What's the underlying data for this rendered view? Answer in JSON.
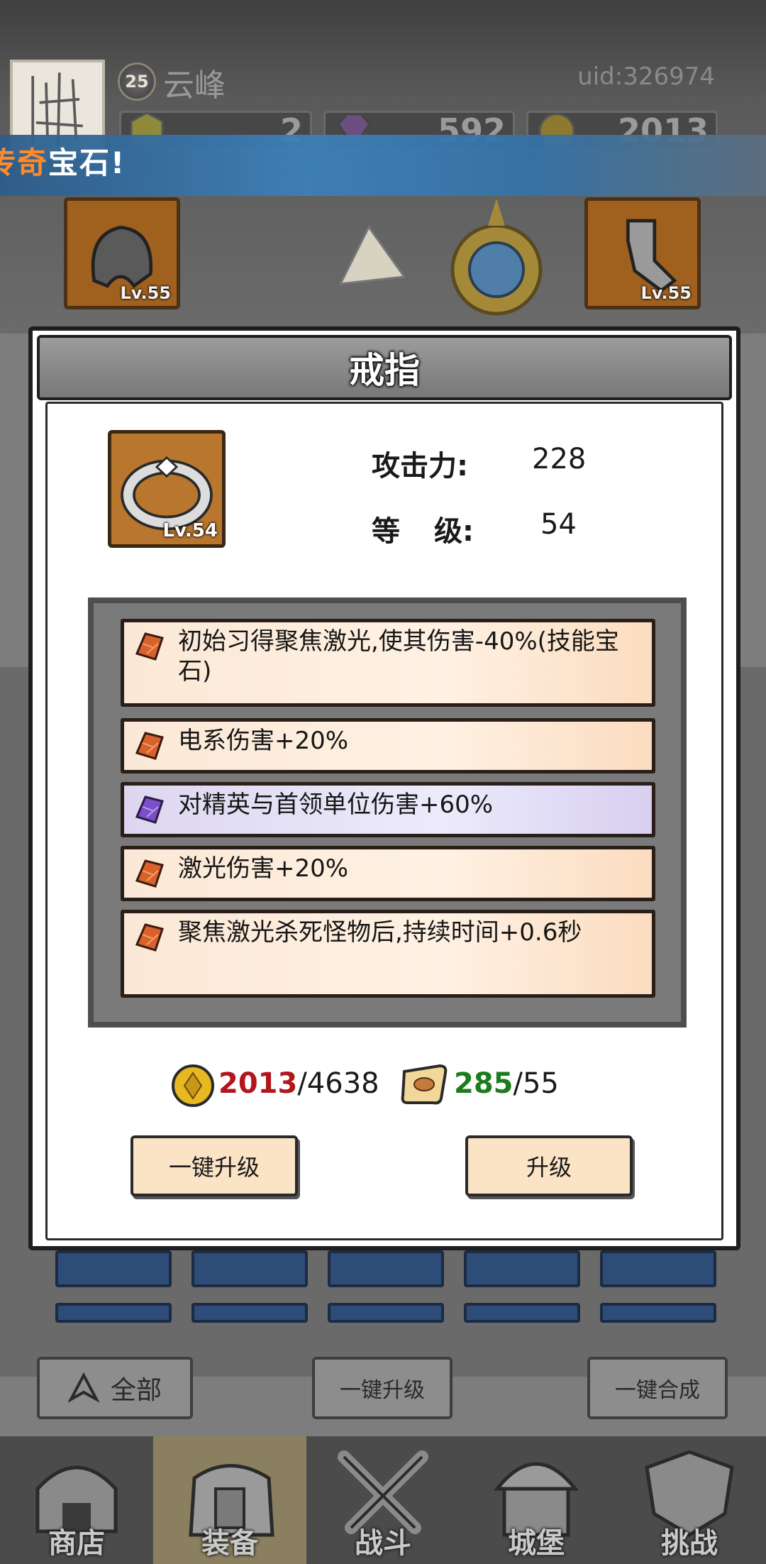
{
  "player": {
    "name": "云峰",
    "level": "25",
    "uid": "uid:326974"
  },
  "currencies": {
    "stamina": "2",
    "gems": "592",
    "coins": "2013"
  },
  "banner": {
    "highlight": "传奇",
    "text": "宝石!"
  },
  "equipment_slots": {
    "left_level": "Lv.55",
    "right_level": "Lv.55"
  },
  "modal": {
    "title": "戒指",
    "item_level": "Lv.54",
    "attack_label": "攻击力:",
    "attack_value": "228",
    "level_label_1": "等",
    "level_label_2": "级:",
    "level_value": "54",
    "attributes": [
      {
        "text": "初始习得聚焦激光,使其伤害-40%(技能宝石)",
        "gem": "orange"
      },
      {
        "text": "电系伤害+20%",
        "gem": "orange"
      },
      {
        "text": "对精英与首领单位伤害+60%",
        "gem": "purple"
      },
      {
        "text": "激光伤害+20%",
        "gem": "orange"
      },
      {
        "text": "聚焦激光杀死怪物后,持续时间+0.6秒",
        "gem": "orange"
      }
    ],
    "cost": {
      "coins_have": "2013",
      "coins_need": "/4638",
      "scrolls_have": "285",
      "scrolls_need": "/55"
    },
    "quick_upgrade_label": "一键升级",
    "upgrade_label": "升级"
  },
  "bottom_buttons": {
    "filter_label": "全部",
    "quick_upgrade_label": "一键升级",
    "quick_merge_label": "一键合成"
  },
  "nav": {
    "items": [
      {
        "label": "商店"
      },
      {
        "label": "装备"
      },
      {
        "label": "战斗"
      },
      {
        "label": "城堡"
      },
      {
        "label": "挑战"
      }
    ],
    "active": "装备"
  },
  "colors": {
    "orange_gem": "#d9622b",
    "purple_gem": "#7a4fc9",
    "banner_highlight": "#ff8a2a",
    "cost_have_red": "#b3151c",
    "cost_have_green": "#1c7c1c"
  }
}
